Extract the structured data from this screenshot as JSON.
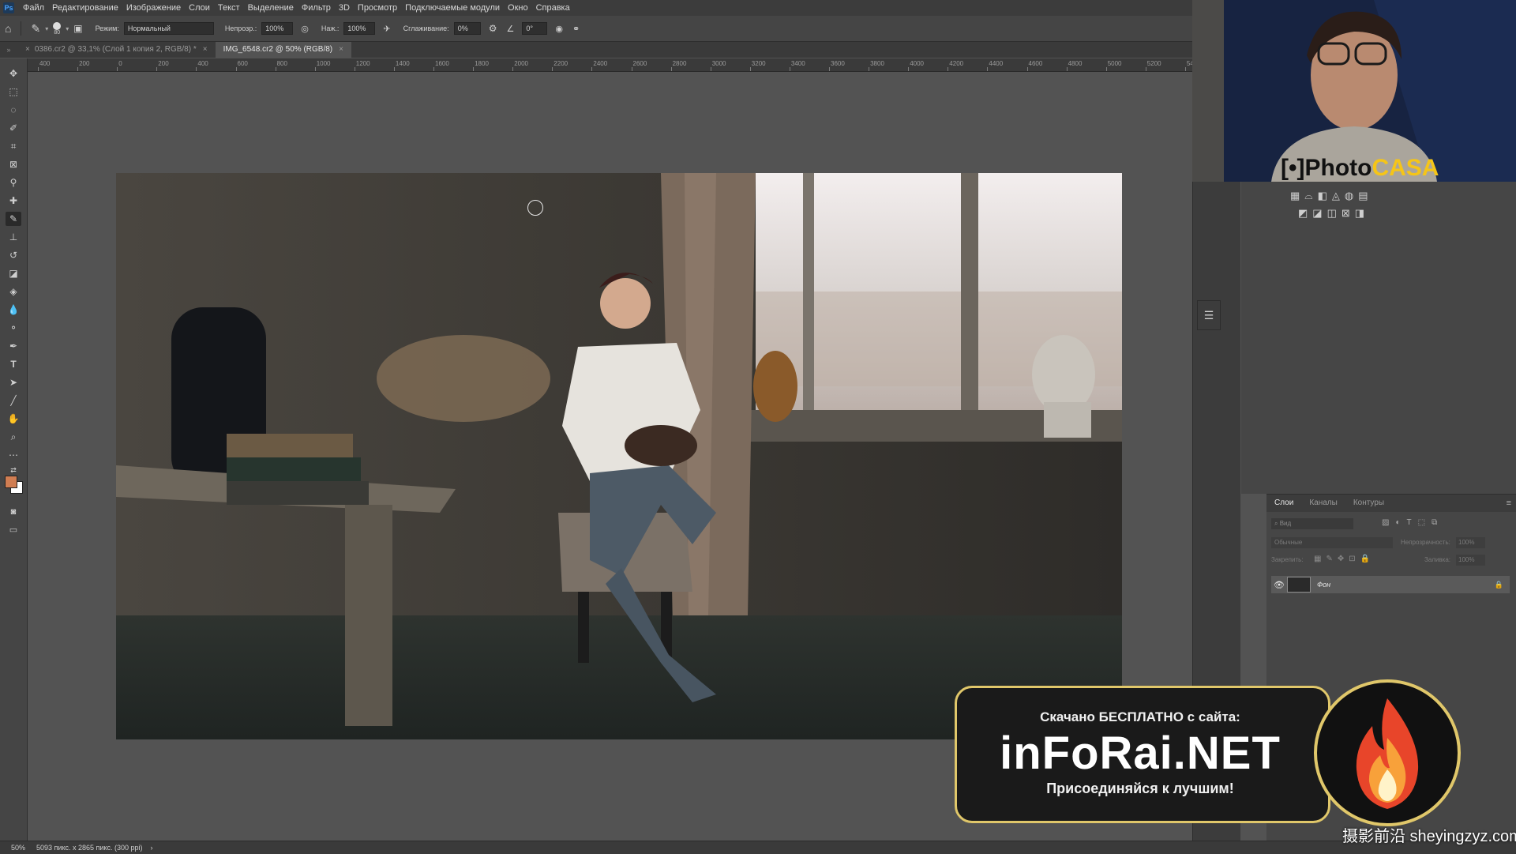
{
  "menu": {
    "items": [
      "Файл",
      "Редактирование",
      "Изображение",
      "Слои",
      "Текст",
      "Выделение",
      "Фильтр",
      "3D",
      "Просмотр",
      "Подключаемые модули",
      "Окно",
      "Справка"
    ]
  },
  "options": {
    "brush_size": "80",
    "mode_label": "Режим:",
    "mode_value": "Нормальный",
    "opacity_label": "Непрозр.:",
    "opacity_value": "100%",
    "flow_label": "Наж.:",
    "flow_value": "100%",
    "smoothing_label": "Сглаживание:",
    "smoothing_value": "0%",
    "angle_value": "0°"
  },
  "tabs": [
    {
      "label": "0386.cr2 @ 33,1% (Слой 1 копия 2, RGB/8) *"
    },
    {
      "label": "IMG_6548.cr2 @ 50% (RGB/8)"
    }
  ],
  "ruler": {
    "h_ticks": [
      "400",
      "200",
      "0",
      "200",
      "400",
      "600",
      "800",
      "1000",
      "1200",
      "1400",
      "1600",
      "1800",
      "2000",
      "2200",
      "2400",
      "2600",
      "2800",
      "3000",
      "3200",
      "3400",
      "3600",
      "3800",
      "4000",
      "4200",
      "4400",
      "4600",
      "4800",
      "5000",
      "5200",
      "54"
    ]
  },
  "layers_panel": {
    "tabs": [
      "Слои",
      "Каналы",
      "Контуры"
    ],
    "search_placeholder": "Вид",
    "blend_mode": "Обычные",
    "opacity_label": "Непрозрачность:",
    "opacity_value": "100%",
    "lock_label": "Закрепить:",
    "fill_label": "Заливка:",
    "fill_value": "100%",
    "layer_name": "Фон"
  },
  "status": {
    "zoom": "50%",
    "doc_info": "5093 пикс. x 2865 пикс. (300 ppi)"
  },
  "webcam": {
    "logo_prefix": "[•]Photo",
    "logo_suffix": "CASA"
  },
  "banner": {
    "line1": "Скачано БЕСПЛАТНО с сайта:",
    "line2": "inFoRai.NET",
    "line3": "Присоединяйся к лучшим!"
  },
  "corner_watermark": "摄影前沿 sheyingzyz.com",
  "colors": {
    "foreground": "#d07d52",
    "background": "#ffffff",
    "accent_yellow": "#f5c518"
  }
}
